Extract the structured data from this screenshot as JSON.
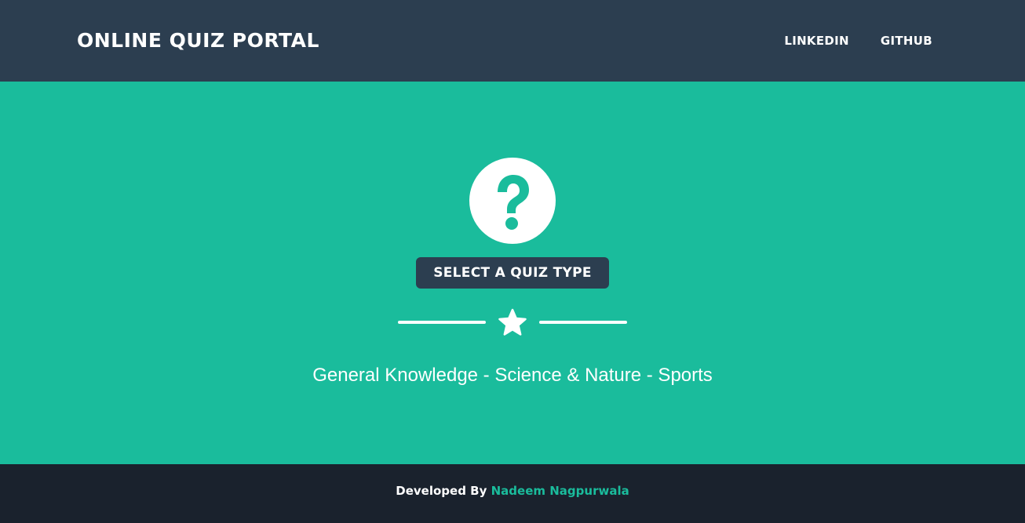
{
  "navbar": {
    "brand": "ONLINE QUIZ PORTAL",
    "links": [
      "LINKEDIN",
      "GITHUB"
    ]
  },
  "hero": {
    "icon": "question-circle-icon",
    "button_label": "SELECT A QUIZ TYPE",
    "divider_icon": "star-icon",
    "categories_text": "General Knowledge - Science & Nature - Sports"
  },
  "footer": {
    "prefix": "Developed By",
    "author": "Nadeem Nagpurwala"
  },
  "colors": {
    "navbar_bg": "#2c3e50",
    "hero_bg": "#1abc9c",
    "footer_bg": "#1a222d",
    "accent": "#1abc9c",
    "text": "#ffffff"
  }
}
